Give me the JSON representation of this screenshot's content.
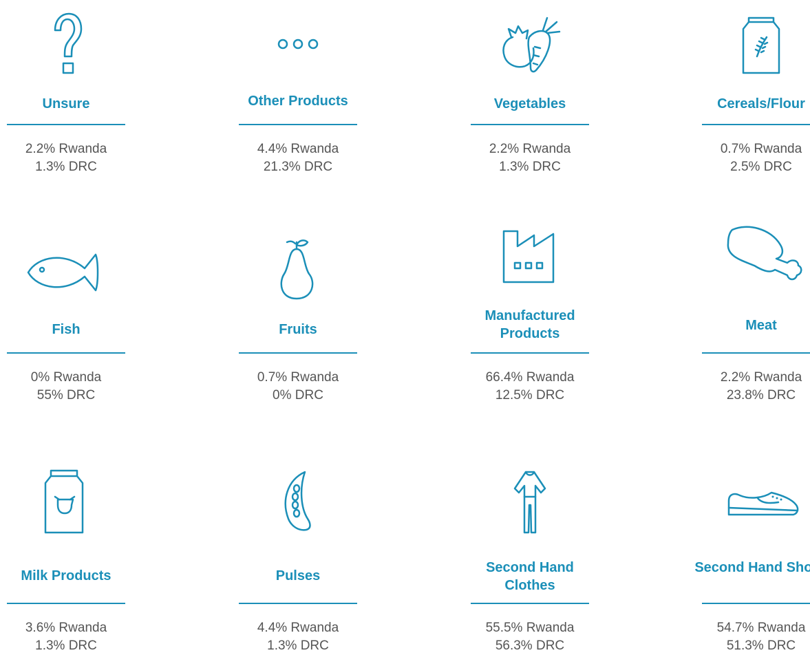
{
  "items": [
    {
      "title": "Unsure",
      "rwanda": "2.2% Rwanda",
      "drc": "1.3% DRC",
      "icon": "question-mark-icon"
    },
    {
      "title": "Other Products",
      "rwanda": "4.4% Rwanda",
      "drc": "21.3% DRC",
      "icon": "ellipsis-icon"
    },
    {
      "title": "Vegetables",
      "rwanda": "2.2% Rwanda",
      "drc": "1.3% DRC",
      "icon": "vegetables-icon"
    },
    {
      "title": "Cereals/Flour",
      "rwanda": "0.7% Rwanda",
      "drc": "2.5% DRC",
      "icon": "flour-bag-icon"
    },
    {
      "title": "Fish",
      "rwanda": "0% Rwanda",
      "drc": "55% DRC",
      "icon": "fish-icon"
    },
    {
      "title": "Fruits",
      "rwanda": "0.7% Rwanda",
      "drc": "0% DRC",
      "icon": "pear-icon"
    },
    {
      "title": "Manufactured Products",
      "rwanda": "66.4% Rwanda",
      "drc": "12.5% DRC",
      "icon": "factory-icon"
    },
    {
      "title": "Meat",
      "rwanda": "2.2% Rwanda",
      "drc": "23.8% DRC",
      "icon": "chicken-leg-icon"
    },
    {
      "title": "Milk Products",
      "rwanda": "3.6% Rwanda",
      "drc": "1.3% DRC",
      "icon": "milk-carton-icon"
    },
    {
      "title": "Pulses",
      "rwanda": "4.4% Rwanda",
      "drc": "1.3% DRC",
      "icon": "pea-pod-icon"
    },
    {
      "title": "Second Hand Clothes",
      "rwanda": "55.5% Rwanda",
      "drc": "56.3% DRC",
      "icon": "clothes-icon"
    },
    {
      "title": "Second Hand Shoes",
      "rwanda": "54.7% Rwanda",
      "drc": "51.3% DRC",
      "icon": "shoe-icon"
    }
  ],
  "colors": {
    "accent": "#1b8fb8",
    "text": "#555555"
  }
}
